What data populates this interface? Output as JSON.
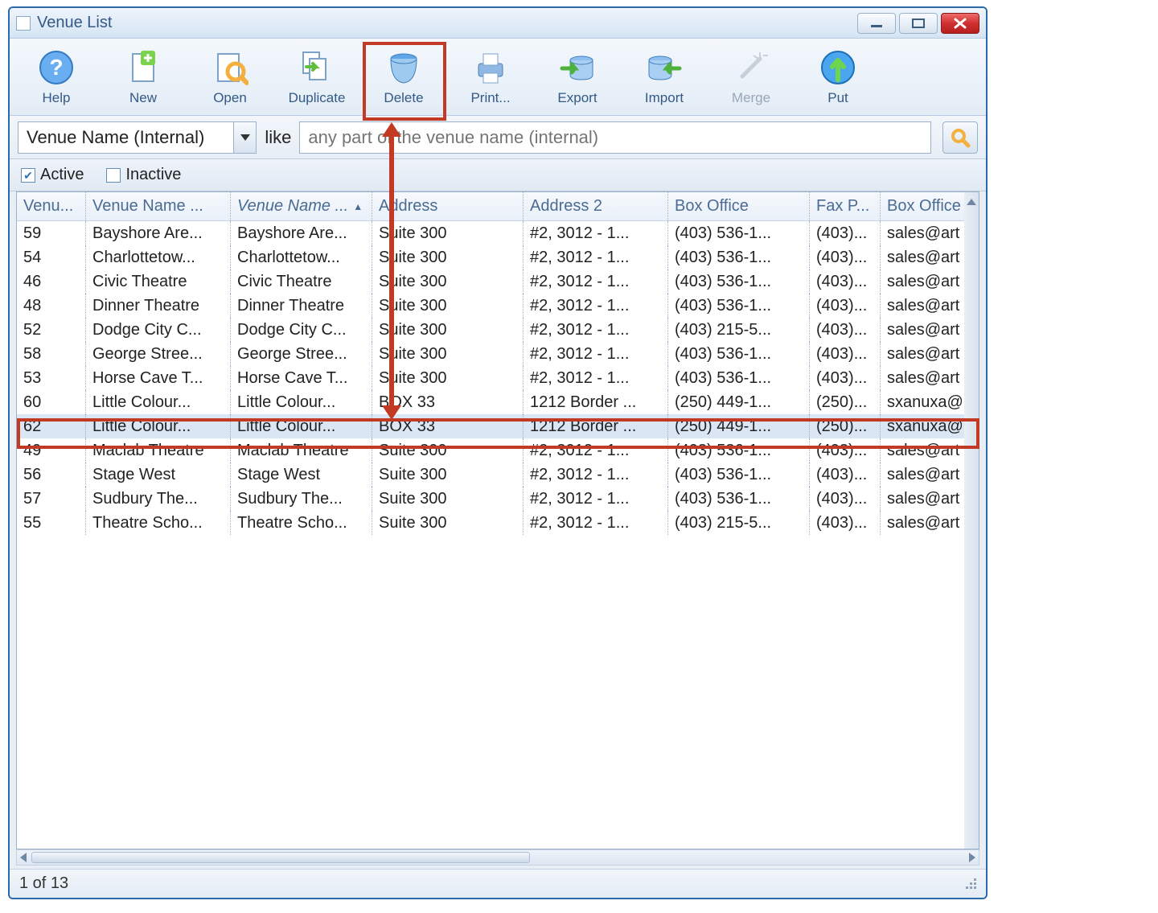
{
  "window": {
    "title": "Venue List"
  },
  "toolbar": {
    "help": "Help",
    "new": "New",
    "open": "Open",
    "duplicate": "Duplicate",
    "delete": "Delete",
    "print": "Print...",
    "export": "Export",
    "import": "Import",
    "merge": "Merge",
    "put": "Put"
  },
  "filter": {
    "fieldLabel": "Venue Name (Internal)",
    "likeLabel": "like",
    "placeholder": "any part of the venue name (internal)"
  },
  "flags": {
    "activeLabel": "Active",
    "inactiveLabel": "Inactive"
  },
  "columns": {
    "c1": "Venu...",
    "c2": "Venue Name ...",
    "c3": "Venue Name ...",
    "c4": "Address",
    "c5": "Address 2",
    "c6": "Box Office",
    "c7": "Fax P...",
    "c8": "Box Office E"
  },
  "rows": [
    {
      "id": "59",
      "n1": "Bayshore Are...",
      "n2": "Bayshore Are...",
      "a1": "Suite 300",
      "a2": "#2, 3012 - 1...",
      "bo": "(403) 536-1...",
      "fax": "(403)...",
      "em": "sales@art"
    },
    {
      "id": "54",
      "n1": "Charlottetow...",
      "n2": "Charlottetow...",
      "a1": "Suite 300",
      "a2": "#2, 3012 - 1...",
      "bo": "(403) 536-1...",
      "fax": "(403)...",
      "em": "sales@art"
    },
    {
      "id": "46",
      "n1": "Civic Theatre",
      "n2": "Civic Theatre",
      "a1": "Suite 300",
      "a2": "#2, 3012 - 1...",
      "bo": "(403) 536-1...",
      "fax": "(403)...",
      "em": "sales@art"
    },
    {
      "id": "48",
      "n1": "Dinner Theatre",
      "n2": "Dinner Theatre",
      "a1": "Suite 300",
      "a2": "#2, 3012 - 1...",
      "bo": "(403) 536-1...",
      "fax": "(403)...",
      "em": "sales@art"
    },
    {
      "id": "52",
      "n1": "Dodge City C...",
      "n2": "Dodge City C...",
      "a1": "Suite 300",
      "a2": "#2, 3012 - 1...",
      "bo": "(403) 215-5...",
      "fax": "(403)...",
      "em": "sales@art"
    },
    {
      "id": "58",
      "n1": "George Stree...",
      "n2": "George Stree...",
      "a1": "Suite 300",
      "a2": "#2, 3012 - 1...",
      "bo": "(403) 536-1...",
      "fax": "(403)...",
      "em": "sales@art"
    },
    {
      "id": "53",
      "n1": "Horse Cave T...",
      "n2": "Horse Cave T...",
      "a1": "Suite 300",
      "a2": "#2, 3012 - 1...",
      "bo": "(403) 536-1...",
      "fax": "(403)...",
      "em": "sales@art"
    },
    {
      "id": "60",
      "n1": "Little Colour...",
      "n2": "Little Colour...",
      "a1": "BOX 33",
      "a2": "1212 Border ...",
      "bo": "(250) 449-1...",
      "fax": "(250)...",
      "em": "sxanuxa@"
    },
    {
      "id": "62",
      "n1": "Little Colour...",
      "n2": "Little Colour...",
      "a1": "BOX 33",
      "a2": "1212 Border ...",
      "bo": "(250) 449-1...",
      "fax": "(250)...",
      "em": "sxanuxa@"
    },
    {
      "id": "49",
      "n1": "Maclab Theatre",
      "n2": "Maclab Theatre",
      "a1": "Suite 300",
      "a2": "#2, 3012 - 1...",
      "bo": "(403) 536-1...",
      "fax": "(403)...",
      "em": "sales@art"
    },
    {
      "id": "56",
      "n1": "Stage West",
      "n2": "Stage West",
      "a1": "Suite 300",
      "a2": "#2, 3012 - 1...",
      "bo": "(403) 536-1...",
      "fax": "(403)...",
      "em": "sales@art"
    },
    {
      "id": "57",
      "n1": "Sudbury The...",
      "n2": "Sudbury The...",
      "a1": "Suite 300",
      "a2": "#2, 3012 - 1...",
      "bo": "(403) 536-1...",
      "fax": "(403)...",
      "em": "sales@art"
    },
    {
      "id": "55",
      "n1": "Theatre Scho...",
      "n2": "Theatre Scho...",
      "a1": "Suite 300",
      "a2": "#2, 3012 - 1...",
      "bo": "(403) 215-5...",
      "fax": "(403)...",
      "em": "sales@art"
    }
  ],
  "selectedRowIndex": 8,
  "status": "1 of 13"
}
